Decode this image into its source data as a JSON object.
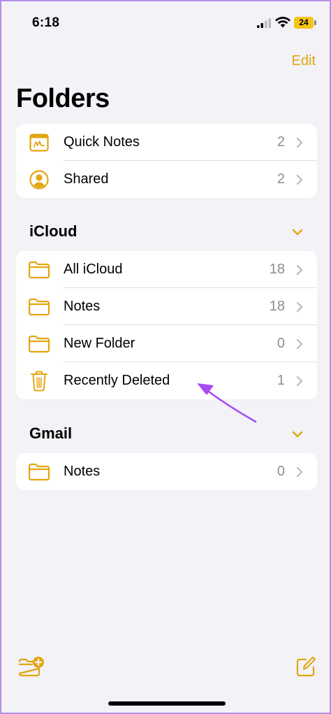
{
  "status_bar": {
    "time": "6:18",
    "battery": "24"
  },
  "header": {
    "edit_label": "Edit",
    "title": "Folders"
  },
  "top_group": [
    {
      "label": "Quick Notes",
      "count": "2",
      "icon": "quick-notes-icon"
    },
    {
      "label": "Shared",
      "count": "2",
      "icon": "person-circle-icon"
    }
  ],
  "sections": [
    {
      "title": "iCloud",
      "items": [
        {
          "label": "All iCloud",
          "count": "18",
          "icon": "folder-icon"
        },
        {
          "label": "Notes",
          "count": "18",
          "icon": "folder-icon"
        },
        {
          "label": "New Folder",
          "count": "0",
          "icon": "folder-icon"
        },
        {
          "label": "Recently Deleted",
          "count": "1",
          "icon": "trash-icon"
        }
      ]
    },
    {
      "title": "Gmail",
      "items": [
        {
          "label": "Notes",
          "count": "0",
          "icon": "folder-icon"
        }
      ]
    }
  ],
  "colors": {
    "accent": "#e3a510",
    "annotation": "#a64bf4",
    "background": "#f2f2f7"
  }
}
